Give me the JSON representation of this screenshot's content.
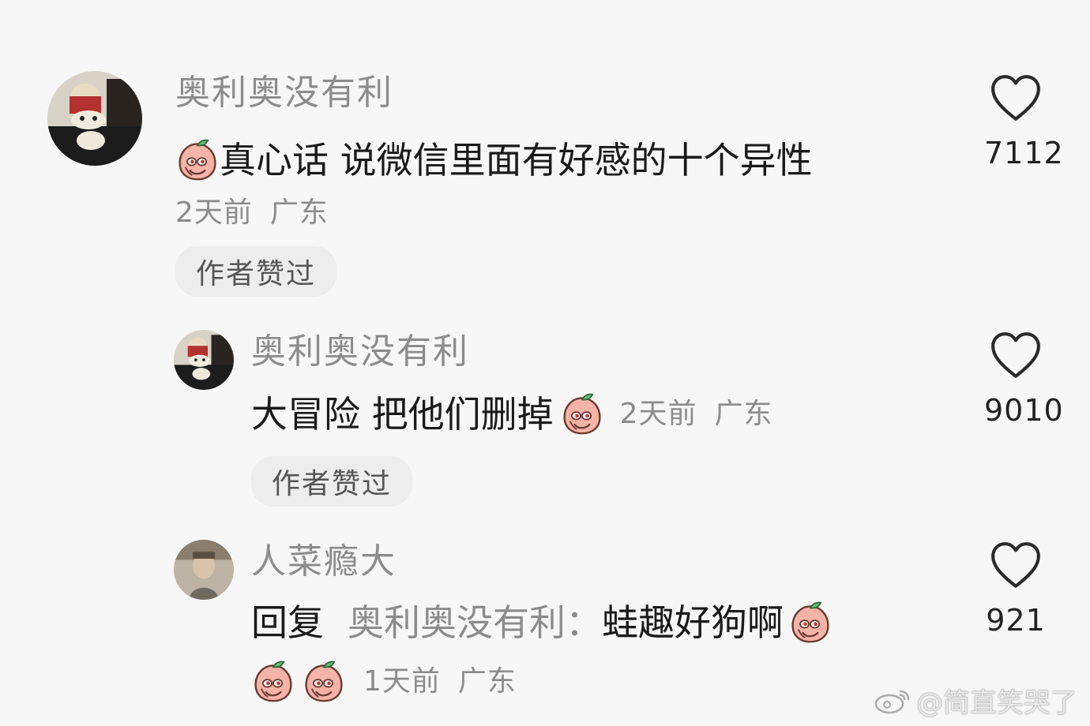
{
  "comments": [
    {
      "username": "奥利奥没有利",
      "text": "真心话 说微信里面有好感的十个异性",
      "time": "2天前",
      "location": "广东",
      "liked_by_author": "作者赞过",
      "like_count": "7112",
      "avatar_icon": "avatar-plush-toy"
    },
    {
      "username": "奥利奥没有利",
      "text": "大冒险 把他们删掉",
      "time": "2天前",
      "location": "广东",
      "liked_by_author": "作者赞过",
      "like_count": "9010",
      "avatar_icon": "avatar-plush-toy"
    },
    {
      "username": "人菜瘾大",
      "reply_prefix": "回复",
      "reply_target": "奥利奥没有利：",
      "text": "蛙趣好狗啊",
      "time": "1天前",
      "location": "广东",
      "like_count": "921",
      "avatar_icon": "avatar-person-photo"
    }
  ],
  "emoji_icon": "peach-face-emoji",
  "like_icon": "heart-outline-icon",
  "watermark": "@简直笑哭了",
  "colors": {
    "background": "#f7f7f7",
    "username": "#8c8c8c",
    "text": "#1a1a1a",
    "tag_bg": "#ededed"
  }
}
